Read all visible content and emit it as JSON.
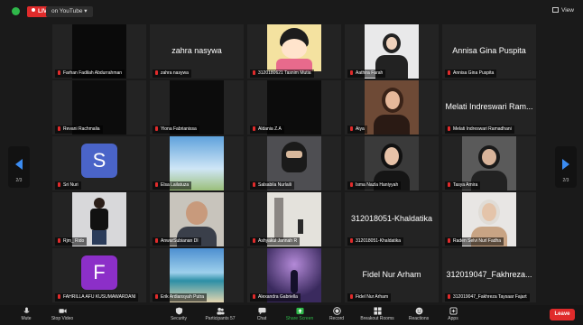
{
  "topbar": {
    "live_label": "LIVE",
    "stream_label": "on YouTube",
    "view_label": "View"
  },
  "nav": {
    "left_page": "2/3",
    "right_page": "2/3"
  },
  "tiles": [
    {
      "label": "Farhan Fadilah Abdurrahman",
      "big": ""
    },
    {
      "label": "zahra nasywa",
      "big": "zahra nasywa"
    },
    {
      "label": "3120180621 Tasnim Mutia",
      "big": ""
    },
    {
      "label": "Aathira Farah",
      "big": ""
    },
    {
      "label": "Annisa Gina Puspita",
      "big": "Annisa Gina Puspita"
    },
    {
      "label": "Revani Rachmalia",
      "big": ""
    },
    {
      "label": "Yiona Fabrianissa",
      "big": ""
    },
    {
      "label": "Aldania Z.A",
      "big": ""
    },
    {
      "label": "Aiya",
      "big": ""
    },
    {
      "label": "Melati Indreswari Ramadhani",
      "big": "Melati Indreswari Ram..."
    },
    {
      "label": "Sri Nuri",
      "big": "",
      "avatar": "S"
    },
    {
      "label": "Elsa Lailatuza",
      "big": ""
    },
    {
      "label": "Salsabila Nurlaili",
      "big": ""
    },
    {
      "label": "Isma Nazla Haniyyah",
      "big": ""
    },
    {
      "label": "Tasya Amira",
      "big": ""
    },
    {
      "label": "Rjm_ Rido",
      "big": ""
    },
    {
      "label": "AnwarSubianan DI",
      "big": ""
    },
    {
      "label": "Ashyakul Jannah R",
      "big": ""
    },
    {
      "label": "312018051-Khaldatika",
      "big": "312018051-Khaldatika"
    },
    {
      "label": "Raden Selvi Nurl Fadha",
      "big": ""
    },
    {
      "label": "FAHRILLA AFU KUSUMAWARDANI",
      "big": "",
      "avatar": "F"
    },
    {
      "label": "Erik Ardiansyah Putra",
      "big": ""
    },
    {
      "label": "Alexandra Gabriella",
      "big": ""
    },
    {
      "label": "Fidel Nur Arham",
      "big": "Fidel Nur Arham"
    },
    {
      "label": "312019047_Fakhreza Taysaar Fajart",
      "big": "312019047_Fakhreza..."
    }
  ],
  "toolbar": {
    "mute": "Mute",
    "stop_video": "Stop Video",
    "security": "Security",
    "participants": "Participants",
    "participants_count": "57",
    "chat": "Chat",
    "share_screen": "Share Screen",
    "record": "Record",
    "breakout": "Breakout Rooms",
    "reactions": "Reactions",
    "apps": "Apps",
    "leave": "Leave"
  },
  "colors": {
    "accent_blue": "#3b8cf2",
    "live_red": "#e02b2b",
    "share_green": "#2fb84a",
    "avatar_s": "#4a64c8",
    "avatar_f": "#8c2fc8"
  }
}
